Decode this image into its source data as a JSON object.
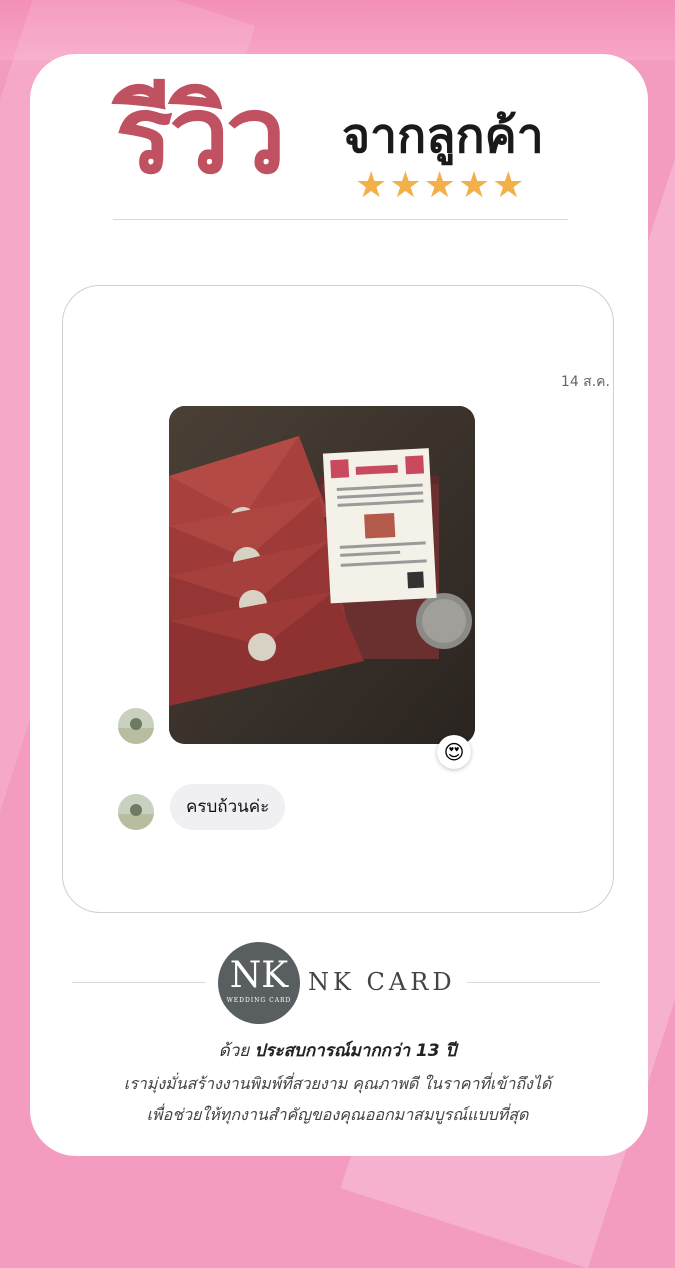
{
  "header": {
    "title_big": "รีวิว",
    "title_small": "จากลูกค้า",
    "stars": "★★★★★",
    "rating": 5
  },
  "chat": {
    "date": "14 ส.ค.",
    "reaction_emoji": "😍",
    "message": "ครบถ้วนค่ะ"
  },
  "brand": {
    "logo_letters": "NK",
    "logo_subtitle": "WEDDING CARD",
    "name": "NK CARD",
    "tagline_prefix": "ด้วย",
    "tagline_bold": "ประสบการณ์มากกว่า 13 ปี",
    "desc_line1": "เรามุ่งมั่นสร้างงานพิมพ์ที่สวยงาม คุณภาพดี ในราคาที่เข้าถึงได้",
    "desc_line2": "เพื่อช่วยให้ทุกงานสำคัญของคุณออกมาสมบูรณ์แบบที่สุด"
  },
  "colors": {
    "accent_pink": "#f49cc0",
    "title_red": "#c05160",
    "star_gold": "#f3b04a",
    "logo_gray": "#595e61"
  }
}
